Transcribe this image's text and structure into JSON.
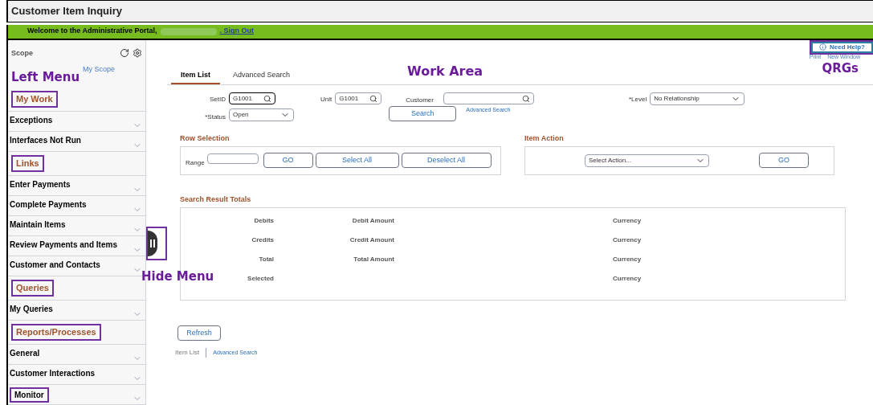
{
  "window": {
    "title": "Customer Item Inquiry"
  },
  "banner": {
    "welcome": "Welcome to the Administrative Portal,",
    "sign_out": ". Sign Out"
  },
  "sidebar": {
    "title": "Scope",
    "scope_link": "My Scope",
    "items": [
      {
        "kind": "section",
        "label": "My Work",
        "highlighted": true
      },
      {
        "kind": "item",
        "label": "Exceptions",
        "highlighted": false
      },
      {
        "kind": "item",
        "label": "Interfaces Not Run",
        "highlighted": false
      },
      {
        "kind": "section",
        "label": "Links",
        "highlighted": true
      },
      {
        "kind": "item",
        "label": "Enter Payments",
        "highlighted": false
      },
      {
        "kind": "item",
        "label": "Complete Payments",
        "highlighted": false
      },
      {
        "kind": "item",
        "label": "Maintain Items",
        "highlighted": false
      },
      {
        "kind": "item",
        "label": "Review Payments and Items",
        "highlighted": false
      },
      {
        "kind": "item",
        "label": "Customer and Contacts",
        "highlighted": false
      },
      {
        "kind": "section",
        "label": "Queries",
        "highlighted": true
      },
      {
        "kind": "item",
        "label": "My Queries",
        "highlighted": false
      },
      {
        "kind": "section",
        "label": "Reports/Processes",
        "highlighted": true
      },
      {
        "kind": "item",
        "label": "General",
        "highlighted": false
      },
      {
        "kind": "item",
        "label": "Customer Interactions",
        "highlighted": false
      },
      {
        "kind": "item",
        "label": "Monitor",
        "highlighted": true
      }
    ]
  },
  "hide_handle": {
    "highlighted": true
  },
  "annotations": {
    "left_menu": "Left Menu",
    "work_area": "Work Area",
    "qrgs": "QRGs",
    "hide_menu": "Hide Menu"
  },
  "help": {
    "label": "Need Help?",
    "highlighted": true
  },
  "page_links": [
    "Print",
    "New Window"
  ],
  "tabs": [
    {
      "label": "Item List",
      "selected": true
    },
    {
      "label": "Advanced Search",
      "selected": false
    }
  ],
  "criteria": {
    "setid_label": "SetID",
    "setid": "G1001",
    "unit_label": "Unit",
    "unit": "G1001",
    "customer_label": "Customer",
    "level_label": "*Level",
    "level": "No Relationship",
    "status_label": "*Status",
    "status": "Open",
    "search": "Search",
    "advanced": "Advanced Search"
  },
  "row_selection": {
    "title": "Row Selection",
    "range_label": "Range",
    "buttons": [
      "GO",
      "Select All",
      "Deselect All"
    ]
  },
  "item_action": {
    "title": "Item Action",
    "select": "Select Action...",
    "button": "GO"
  },
  "totals": {
    "title": "Search Result Totals",
    "rows": [
      {
        "label": "Debits",
        "amount": "Debit Amount",
        "currency": "Currency"
      },
      {
        "label": "Credits",
        "amount": "Credit Amount",
        "currency": "Currency"
      },
      {
        "label": "Total",
        "amount": "Total Amount",
        "currency": "Currency"
      },
      {
        "label": "Selected",
        "currency": "Currency"
      }
    ]
  },
  "refresh": "Refresh",
  "footer_links": [
    {
      "label": "Item List",
      "selected": true
    },
    {
      "label": "Advanced Search",
      "selected": false
    }
  ]
}
